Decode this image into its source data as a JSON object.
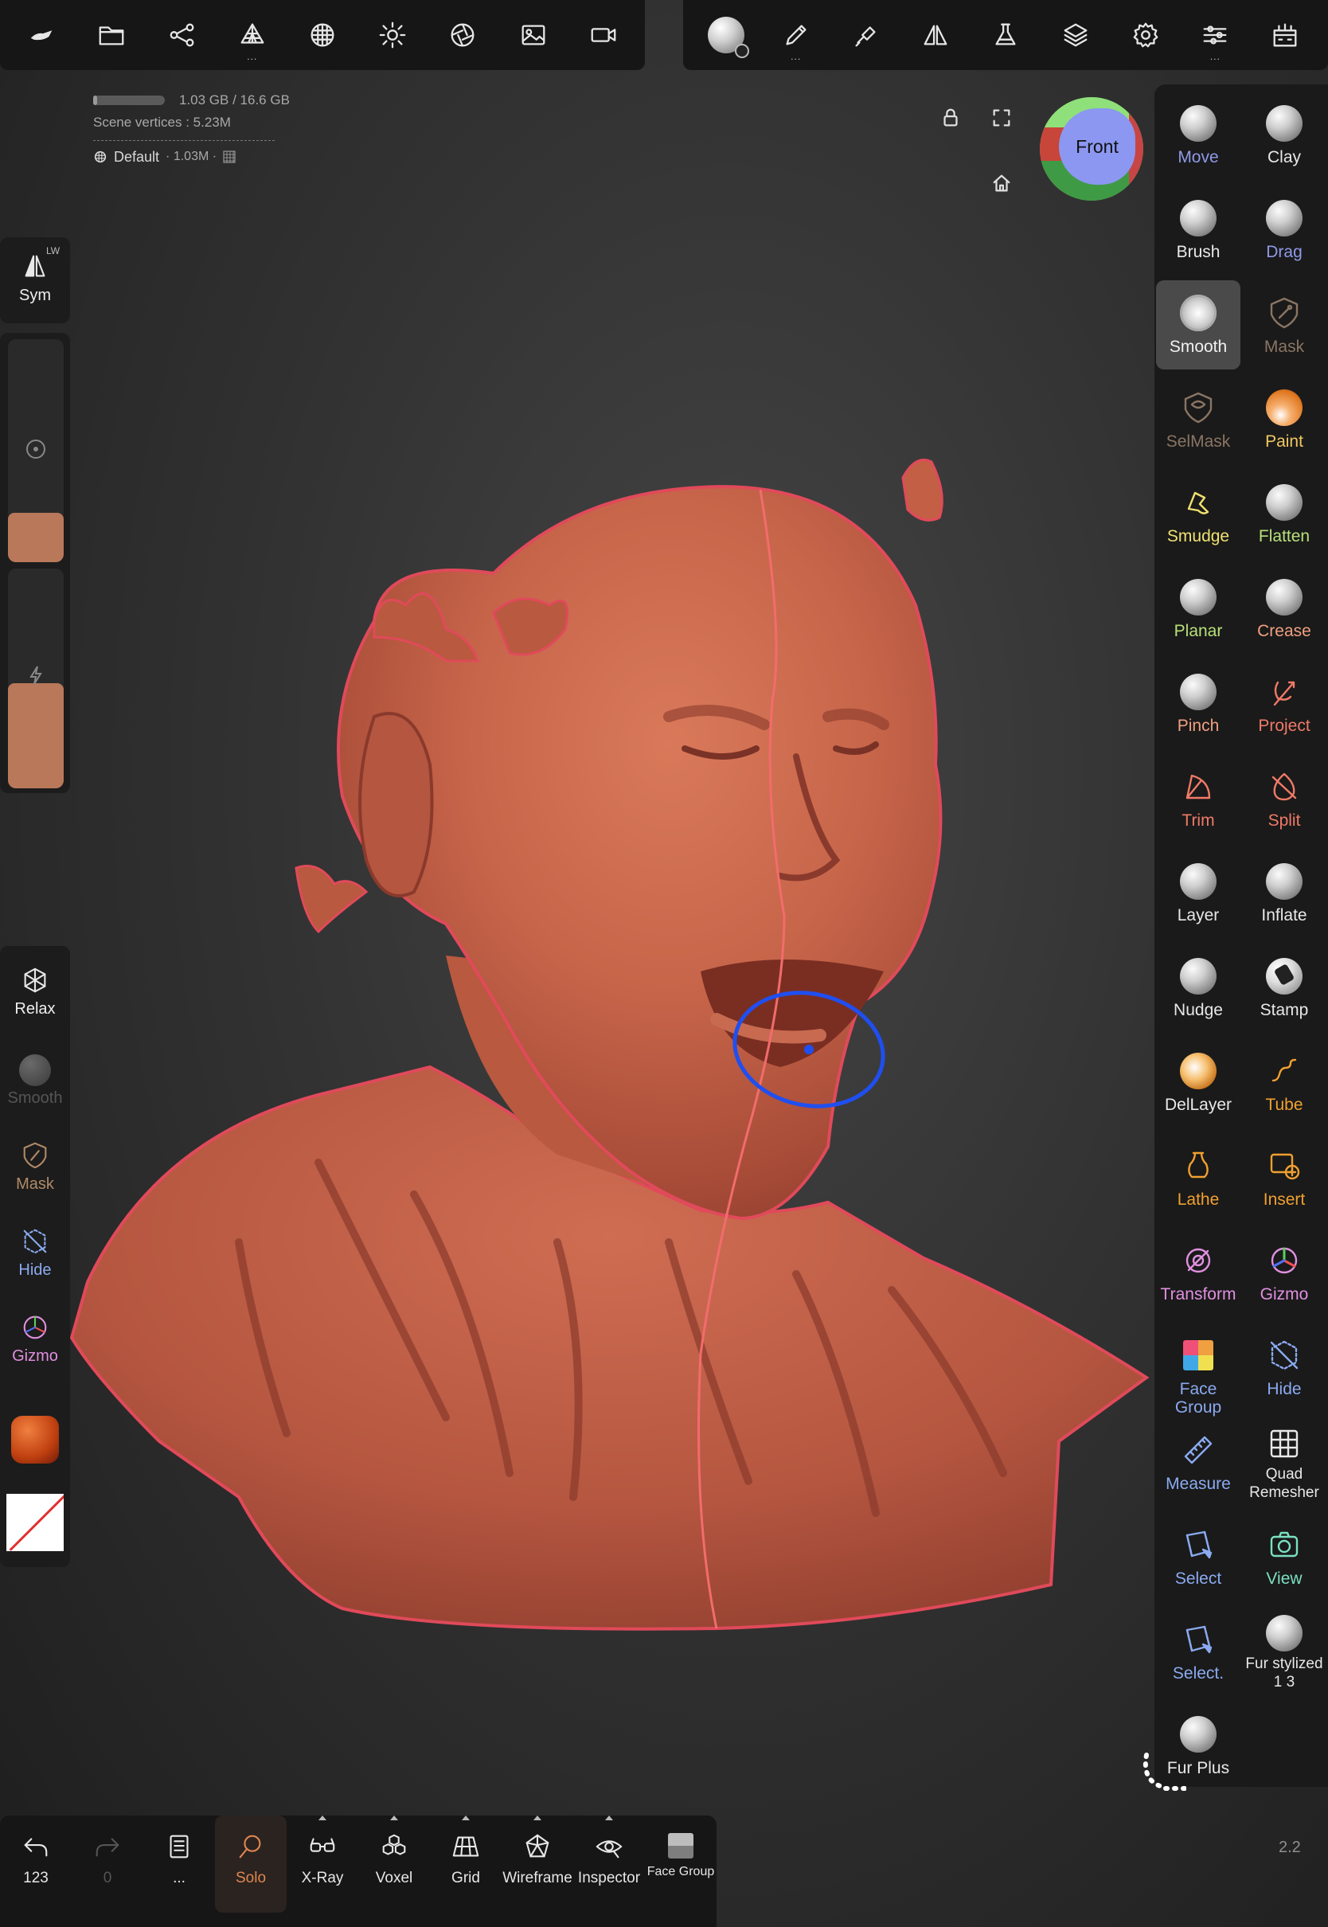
{
  "colors": {
    "accent_orange": "#f0a030",
    "solo_active": "#e0864f",
    "brush_blue": "#6f8ff5",
    "sculpt_color": "#b9785a",
    "mask_brown": "#b08a68",
    "green_tool": "#b8e07a",
    "red_tool": "#f08070",
    "blue_tool": "#8aaaf0"
  },
  "info": {
    "memory": "1.03 GB / 16.6 GB",
    "memory_fraction": 0.06,
    "scene_vertices": "Scene vertices :  5.23M",
    "material_label": "Default",
    "material_detail": "· 1.03M ·"
  },
  "viewcube": {
    "front_label": "Front"
  },
  "left": {
    "sym_label": "Sym",
    "sym_badge": "LW",
    "size_fraction": 0.22,
    "intensity_fraction": 0.48,
    "relax_label": "Relax",
    "smooth_label": "Smooth",
    "mask_label": "Mask",
    "hide_label": "Hide",
    "gizmo_label": "Gizmo"
  },
  "tools": [
    {
      "label": "Move",
      "color": "#8f9ae8",
      "icon": "sphere"
    },
    {
      "label": "Clay",
      "color": "#e8e8e8",
      "icon": "sphere"
    },
    {
      "label": "Brush",
      "color": "#e8e8e8",
      "icon": "sphere"
    },
    {
      "label": "Drag",
      "color": "#8f9ae8",
      "icon": "sphere"
    },
    {
      "label": "Smooth",
      "color": "#f0f0f0",
      "icon": "smooth-sphere",
      "active": true
    },
    {
      "label": "Mask",
      "color": "#8a7563",
      "icon": "mask"
    },
    {
      "label": "SelMask",
      "color": "#8a7563",
      "icon": "selmask"
    },
    {
      "label": "Paint",
      "color": "#f0c860",
      "icon": "paint-sphere"
    },
    {
      "label": "Smudge",
      "color": "#f0e070",
      "icon": "smudge"
    },
    {
      "label": "Flatten",
      "color": "#b8e07a",
      "icon": "sphere"
    },
    {
      "label": "Planar",
      "color": "#b8e07a",
      "icon": "sphere"
    },
    {
      "label": "Crease",
      "color": "#f0a080",
      "icon": "sphere"
    },
    {
      "label": "Pinch",
      "color": "#f0a080",
      "icon": "sphere"
    },
    {
      "label": "Project",
      "color": "#f07a68",
      "icon": "project"
    },
    {
      "label": "Trim",
      "color": "#f07a68",
      "icon": "trim"
    },
    {
      "label": "Split",
      "color": "#f07a68",
      "icon": "split"
    },
    {
      "label": "Layer",
      "color": "#e8e8e8",
      "icon": "sphere"
    },
    {
      "label": "Inflate",
      "color": "#e8e8e8",
      "icon": "sphere"
    },
    {
      "label": "Nudge",
      "color": "#e8e8e8",
      "icon": "sphere"
    },
    {
      "label": "Stamp",
      "color": "#e8e8e8",
      "icon": "stamp"
    },
    {
      "label": "DelLayer",
      "color": "#e8e8e8",
      "icon": "dellayer"
    },
    {
      "label": "Tube",
      "color": "#f0a030",
      "icon": "tube"
    },
    {
      "label": "Lathe",
      "color": "#f0a030",
      "icon": "lathe"
    },
    {
      "label": "Insert",
      "color": "#f0a030",
      "icon": "insert"
    },
    {
      "label": "Transform",
      "color": "#e090e0",
      "icon": "transform"
    },
    {
      "label": "Gizmo",
      "color": "#e090e0",
      "icon": "gizmo"
    },
    {
      "label": "Face Group",
      "color": "#8aaaf0",
      "icon": "facegroup"
    },
    {
      "label": "Hide",
      "color": "#8aaaf0",
      "icon": "hide"
    },
    {
      "label": "Measure",
      "color": "#8aaaf0",
      "icon": "measure"
    },
    {
      "label": "Quad Remesher",
      "color": "#e8e8e8",
      "icon": "quadremesher"
    },
    {
      "label": "Select",
      "color": "#8aaaf0",
      "icon": "select"
    },
    {
      "label": "View",
      "color": "#7ae0c0",
      "icon": "view"
    },
    {
      "label": "Select.",
      "color": "#8aaaf0",
      "icon": "select"
    },
    {
      "label": "Fur stylized 1 3",
      "color": "#e8e8e8",
      "icon": "sphere"
    },
    {
      "label": "Fur Plus",
      "color": "#e8e8e8",
      "icon": "sphere"
    }
  ],
  "bottom": {
    "undo_count": "123",
    "redo_count": "0",
    "scene_label": "...",
    "solo": "Solo",
    "xray": "X-Ray",
    "voxel": "Voxel",
    "grid": "Grid",
    "wireframe": "Wireframe",
    "inspector": "Inspector",
    "face_group": "Face Group"
  },
  "version": "2.2"
}
